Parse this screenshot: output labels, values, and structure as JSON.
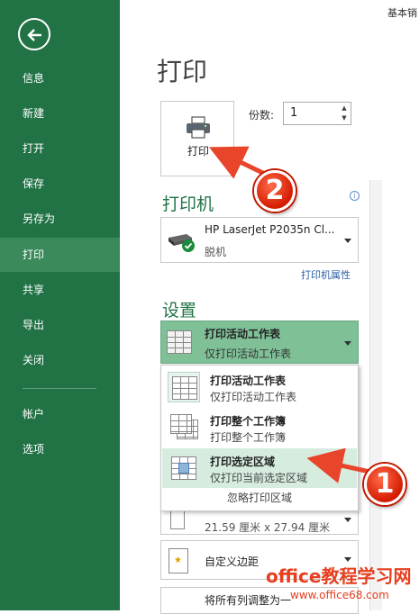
{
  "doc_title": "基本销",
  "nav": {
    "items": [
      {
        "label": "信息"
      },
      {
        "label": "新建"
      },
      {
        "label": "打开"
      },
      {
        "label": "保存"
      },
      {
        "label": "另存为"
      },
      {
        "label": "打印"
      },
      {
        "label": "共享"
      },
      {
        "label": "导出"
      },
      {
        "label": "关闭"
      },
      {
        "label": "帐户"
      },
      {
        "label": "选项"
      }
    ],
    "active": "打印"
  },
  "page_title": "打印",
  "print_button": {
    "label": "打印"
  },
  "copies": {
    "label": "份数:",
    "value": "1"
  },
  "printer_section": {
    "heading": "打印机",
    "info_glyph": "i",
    "printer_name": "HP LaserJet P2035n Cl...",
    "status": "脱机",
    "properties_link": "打印机属性"
  },
  "settings_section": {
    "heading": "设置",
    "selected": {
      "title": "打印活动工作表",
      "subtitle": "仅打印活动工作表"
    },
    "options": [
      {
        "title": "打印活动工作表",
        "subtitle": "仅打印活动工作表"
      },
      {
        "title": "打印整个工作簿",
        "subtitle": "打印整个工作簿"
      },
      {
        "title": "打印选定区域",
        "subtitle": "仅打印当前选定区域"
      }
    ],
    "ignore_print_area": "忽略打印区域",
    "paper_size": "21.59 厘米 x 27.94 厘米",
    "margins": "自定义边距",
    "scaling": "将所有列调整为一"
  },
  "annotations": {
    "badge1": "1",
    "badge2": "2"
  },
  "watermark": {
    "line1": "office教程学习网",
    "line2": "www.office68.com"
  },
  "colors": {
    "sidebar": "#217346",
    "accent": "#217346",
    "highlight": "#d6ecdf",
    "annotation": "#e63f1f"
  }
}
